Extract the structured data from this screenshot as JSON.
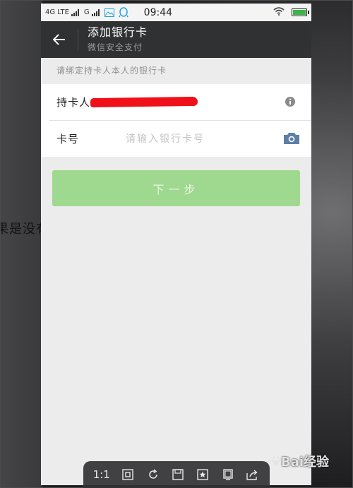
{
  "backdrop": {
    "side_text": "果是没有"
  },
  "status_bar": {
    "network_1": "4G LTE",
    "network_2": "G",
    "time": "09:44"
  },
  "title_bar": {
    "title": "添加银行卡",
    "subtitle": "微信安全支付"
  },
  "form": {
    "hint": "请绑定持卡人本人的银行卡",
    "holder_label": "持卡人",
    "card_label": "卡号",
    "card_placeholder": "请输入银行卡号"
  },
  "next_button": {
    "label": "下一步"
  },
  "viewer_toolbar": {
    "zoom_label": "1:1"
  },
  "watermark": {
    "text": "Bai经验"
  },
  "colors": {
    "title_bar": "#2f3133",
    "button": "#9fd88f",
    "redaction": "#f0101a",
    "battery": "#3ab54a",
    "qq_icon": "#1fa0e4"
  },
  "icons": [
    "back-arrow-icon",
    "info-icon",
    "camera-icon",
    "wifi-icon",
    "battery-icon",
    "qq-icon",
    "gallery-icon",
    "paw-icon"
  ]
}
